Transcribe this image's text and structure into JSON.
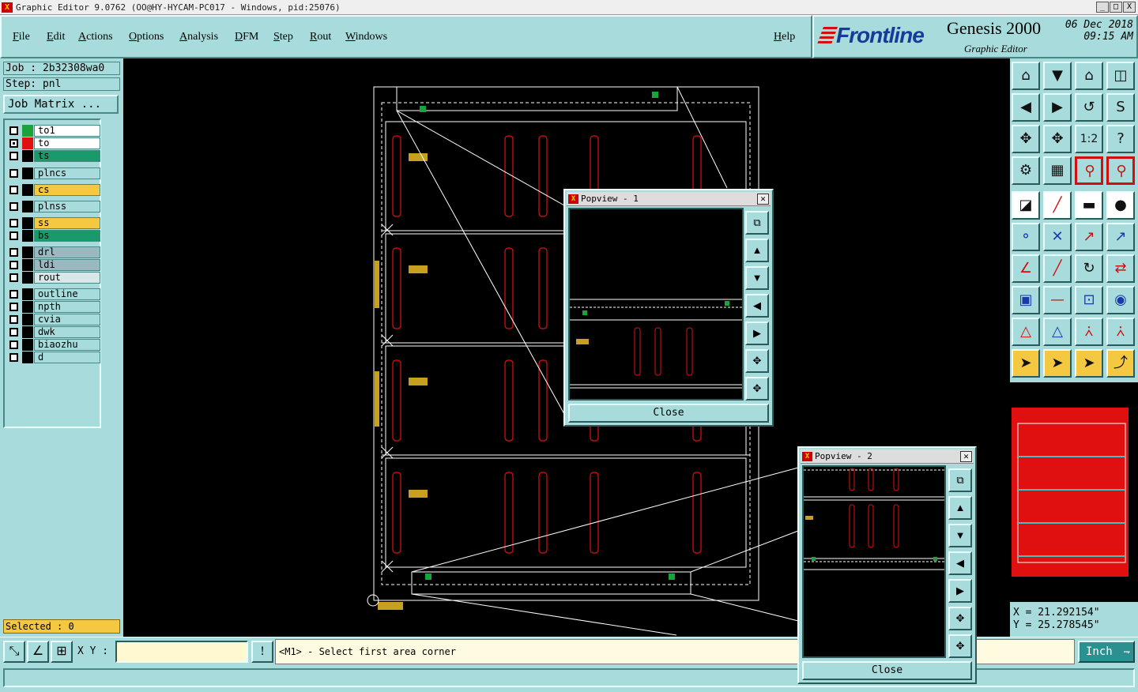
{
  "window": {
    "title": "Graphic Editor 9.0762 (OO@HY-HYCAM-PC017 - Windows, pid:25076)",
    "controls": [
      "_",
      "□",
      "X"
    ]
  },
  "menu": {
    "items": [
      "File",
      "Edit",
      "Actions",
      "Options",
      "Analysis",
      "DFM",
      "Step",
      "Rout",
      "Windows"
    ],
    "help": "Help"
  },
  "brand": {
    "logo": "Frontline",
    "product": "Genesis 2000",
    "subtitle": "Graphic Editor",
    "date": "06 Dec 2018",
    "time": "09:15 AM"
  },
  "job": {
    "job_label": "Job : 2b32308wa0",
    "step_label": "Step: pnl",
    "job_matrix_button": "Job Matrix ..."
  },
  "layers": [
    {
      "name": "to1",
      "color": "#ffffff",
      "swatch": "#1aa33a",
      "checked": false
    },
    {
      "name": "to",
      "color": "#ffffff",
      "swatch": "#e01010",
      "checked": true
    },
    {
      "name": "ts",
      "color": "#1a9a6a",
      "swatch": "#000000",
      "checked": false
    },
    {
      "name": "plncs",
      "color": "#a8dcdc",
      "swatch": "#000000",
      "checked": false
    },
    {
      "name": "cs",
      "color": "#f5c842",
      "swatch": "#000000",
      "checked": false
    },
    {
      "name": "plnss",
      "color": "#a8dcdc",
      "swatch": "#000000",
      "checked": false
    },
    {
      "name": "ss",
      "color": "#f5c842",
      "swatch": "#000000",
      "checked": false
    },
    {
      "name": "bs",
      "color": "#1a9a6a",
      "swatch": "#000000",
      "checked": false
    },
    {
      "name": "drl",
      "color": "#9ab8c0",
      "swatch": "#000000",
      "checked": false
    },
    {
      "name": "ldi",
      "color": "#9ab8c0",
      "swatch": "#000000",
      "checked": false
    },
    {
      "name": "rout",
      "color": "#d8e8e8",
      "swatch": "#000000",
      "checked": false
    },
    {
      "name": "outline",
      "color": "#a8dcdc",
      "swatch": "#000000",
      "checked": false
    },
    {
      "name": "npth",
      "color": "#a8dcdc",
      "swatch": "#000000",
      "checked": false
    },
    {
      "name": "cvia",
      "color": "#a8dcdc",
      "swatch": "#000000",
      "checked": false
    },
    {
      "name": "dwk",
      "color": "#a8dcdc",
      "swatch": "#000000",
      "checked": false
    },
    {
      "name": "biaozhu",
      "color": "#a8dcdc",
      "swatch": "#000000",
      "checked": false
    },
    {
      "name": "d",
      "color": "#a8dcdc",
      "swatch": "#000000",
      "checked": false
    }
  ],
  "selected": "Selected : 0",
  "coords": {
    "x": "X = 21.292154\"",
    "y": "Y = 25.278545\""
  },
  "bottom": {
    "xy_label": "X Y :",
    "xy_value": "",
    "info_button": "!",
    "prompt": "<M1> - Select first area corner",
    "units": "Inch"
  },
  "popview1": {
    "title": "Popview - 1",
    "close": "Close"
  },
  "popview2": {
    "title": "Popview - 2",
    "close": "Close"
  },
  "tools": {
    "zoom_ratio_label": "1:2",
    "help_label": "?"
  }
}
